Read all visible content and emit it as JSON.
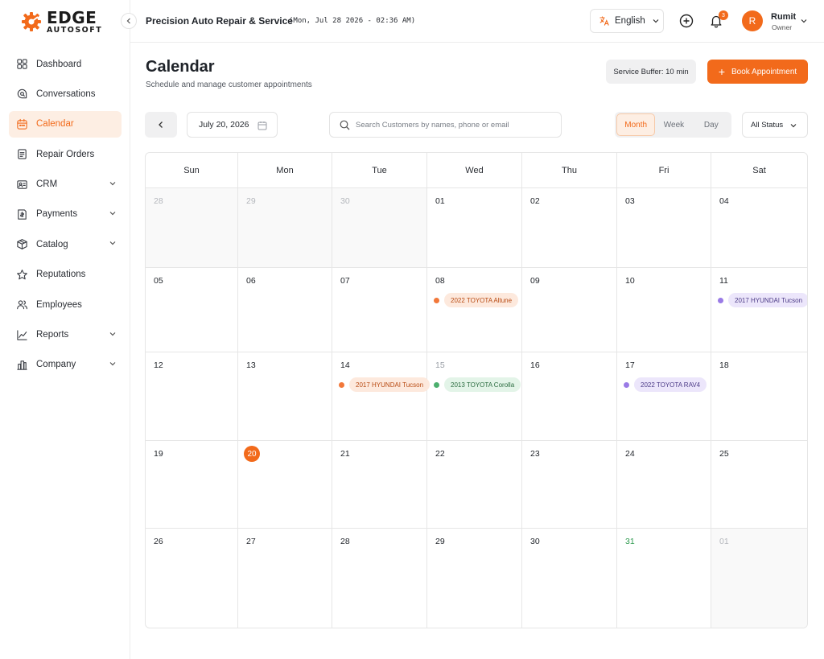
{
  "brand": {
    "name": "EDGE",
    "sub": "AUTOSOFT",
    "accent": "#f26a1b"
  },
  "sidebar": {
    "items": [
      {
        "label": "Dashboard",
        "icon": "grid-icon",
        "active": false,
        "expandable": false
      },
      {
        "label": "Conversations",
        "icon": "chat-search-icon",
        "active": false,
        "expandable": false
      },
      {
        "label": "Calendar",
        "icon": "calendar-icon",
        "active": true,
        "expandable": false
      },
      {
        "label": "Repair Orders",
        "icon": "document-icon",
        "active": false,
        "expandable": false
      },
      {
        "label": "CRM",
        "icon": "id-card-icon",
        "active": false,
        "expandable": true
      },
      {
        "label": "Payments",
        "icon": "invoice-icon",
        "active": false,
        "expandable": true
      },
      {
        "label": "Catalog",
        "icon": "box-icon",
        "active": false,
        "expandable": true
      },
      {
        "label": "Reputations",
        "icon": "star-icon",
        "active": false,
        "expandable": false
      },
      {
        "label": "Employees",
        "icon": "users-icon",
        "active": false,
        "expandable": false
      },
      {
        "label": "Reports",
        "icon": "chart-line-icon",
        "active": false,
        "expandable": true
      },
      {
        "label": "Company",
        "icon": "building-icon",
        "active": false,
        "expandable": true
      }
    ]
  },
  "header": {
    "shop_name": "Precision Auto Repair & Service",
    "datetime": "(Mon, Jul 28 2026 - 02:36 AM)",
    "language": "English",
    "notifications": "3",
    "user": {
      "initial": "R",
      "name": "Rumit",
      "role": "Owner"
    }
  },
  "page": {
    "title": "Calendar",
    "subtitle": "Schedule and manage customer appointments",
    "service_buffer": "Service Buffer: 10 min",
    "book_label": "Book Appointment"
  },
  "toolbar": {
    "date": "July 20, 2026",
    "search_placeholder": "Search Customers by names, phone or email",
    "views": [
      "Month",
      "Week",
      "Day"
    ],
    "active_view": "Month",
    "status": "All Status"
  },
  "calendar": {
    "weekdays": [
      "Sun",
      "Mon",
      "Tue",
      "Wed",
      "Thu",
      "Fri",
      "Sat"
    ],
    "weeks": [
      [
        {
          "d": "28",
          "other": true
        },
        {
          "d": "29",
          "other": true
        },
        {
          "d": "30",
          "other": true
        },
        {
          "d": "01"
        },
        {
          "d": "02"
        },
        {
          "d": "03"
        },
        {
          "d": "04"
        }
      ],
      [
        {
          "d": "05"
        },
        {
          "d": "06"
        },
        {
          "d": "07"
        },
        {
          "d": "08",
          "event": {
            "label": "2022 TOYOTA Altune",
            "color": "orange"
          }
        },
        {
          "d": "09"
        },
        {
          "d": "10"
        },
        {
          "d": "11",
          "event": {
            "label": "2017 HYUNDAI Tucson",
            "color": "purple"
          }
        }
      ],
      [
        {
          "d": "12"
        },
        {
          "d": "13"
        },
        {
          "d": "14",
          "event": {
            "label": "2017 HYUNDAI Tucson",
            "color": "orange"
          }
        },
        {
          "d": "15",
          "past": true,
          "event": {
            "label": "2013 TOYOTA Corolla",
            "color": "green"
          }
        },
        {
          "d": "16"
        },
        {
          "d": "17",
          "event": {
            "label": "2022 TOYOTA RAV4",
            "color": "purple"
          }
        },
        {
          "d": "18"
        }
      ],
      [
        {
          "d": "19"
        },
        {
          "d": "20",
          "today": true
        },
        {
          "d": "21"
        },
        {
          "d": "22"
        },
        {
          "d": "23"
        },
        {
          "d": "24"
        },
        {
          "d": "25"
        }
      ],
      [
        {
          "d": "26"
        },
        {
          "d": "27"
        },
        {
          "d": "28"
        },
        {
          "d": "29"
        },
        {
          "d": "30"
        },
        {
          "d": "31",
          "green": true
        },
        {
          "d": "01",
          "other": true
        }
      ]
    ],
    "event_colors": {
      "orange": {
        "dot": "#f2783a",
        "bg": "#fde9dd",
        "text": "#b84a12"
      },
      "purple": {
        "dot": "#9a7be6",
        "bg": "#ece6fb",
        "text": "#4b3a86"
      },
      "green": {
        "dot": "#4caf6e",
        "bg": "#e3f4e8",
        "text": "#2a6b3f"
      }
    }
  }
}
